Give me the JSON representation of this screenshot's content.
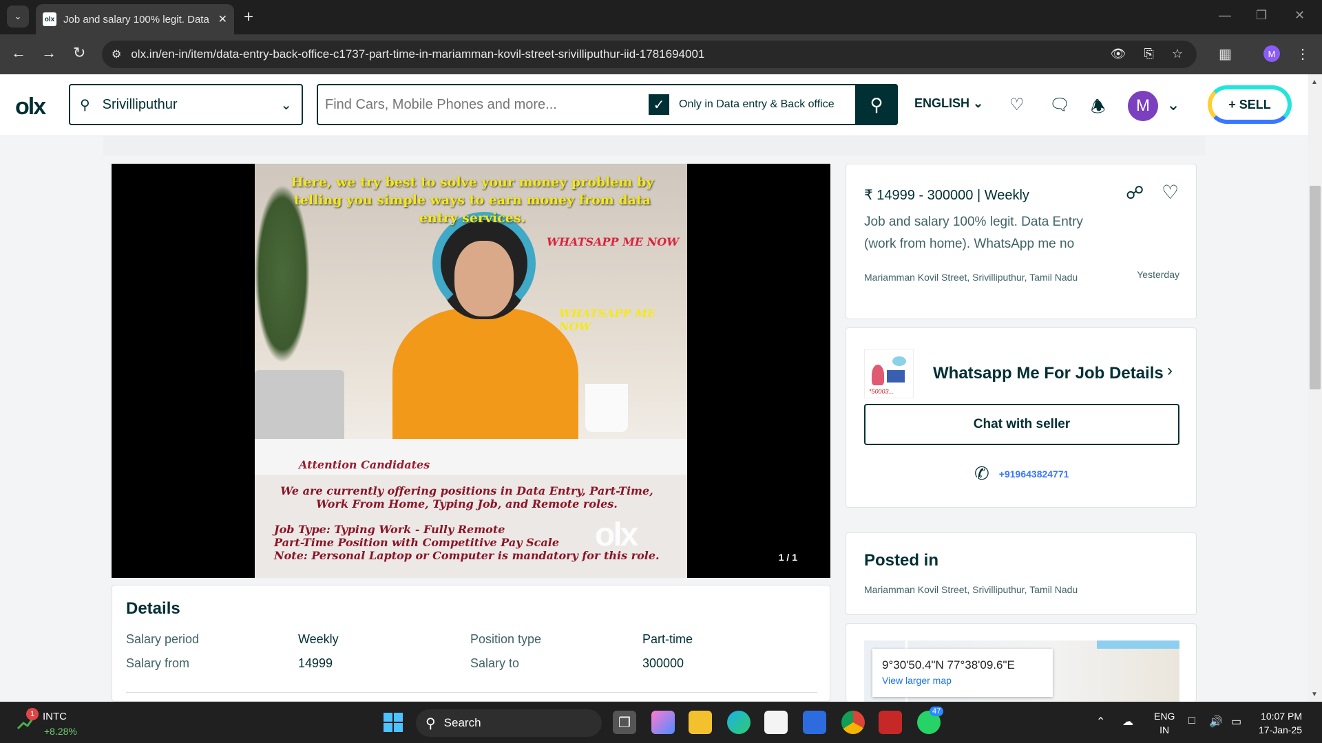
{
  "browser": {
    "tab_title": "Job and salary 100% legit. Data",
    "url": "olx.in/en-in/item/data-entry-back-office-c1737-part-time-in-mariamman-kovil-street-srivilliputhur-iid-1781694001",
    "profile_initial": "M"
  },
  "header": {
    "logo": "olx",
    "location": "Srivilliputhur",
    "search_placeholder": "Find Cars, Mobile Phones and more...",
    "filter_label": "Only in Data entry & Back office",
    "language": "ENGLISH",
    "avatar_initial": "M",
    "sell_label": "SELL"
  },
  "ad_image": {
    "headline": "Here, we try best to solve your money problem by telling you simple ways to earn money from data entry services.",
    "whatsapp_1": "WHATSAPP ME NOW",
    "whatsapp_2": "WHATSAPP ME NOW",
    "attention": "Attention Candidates",
    "line1": "We are currently offering positions in Data Entry, Part-Time, Work From Home, Typing Job, and Remote roles.",
    "line2": "Job Type: Typing Work - Fully Remote",
    "line3": "Part-Time Position with Competitive Pay Scale",
    "line4": "Note: Personal Laptop or Computer is mandatory for this role.",
    "watermark": "olx",
    "counter": "1 / 1"
  },
  "details": {
    "heading": "Details",
    "rows": [
      {
        "k1": "Salary period",
        "v1": "Weekly",
        "k2": "Position type",
        "v2": "Part-time"
      },
      {
        "k1": "Salary from",
        "v1": "14999",
        "k2": "Salary to",
        "v2": "300000"
      }
    ]
  },
  "summary": {
    "price": "₹ 14999 - 300000 | Weekly",
    "title": "Job and salary 100% legit. Data Entry (work from home). WhatsApp me no",
    "location": "Mariamman Kovil Street, Srivilliputhur, Tamil Nadu",
    "date": "Yesterday"
  },
  "seller": {
    "thumb_text": "*50003...",
    "name": "Whatsapp Me For Job Details",
    "chat_label": "Chat with seller",
    "phone": "+919643824771"
  },
  "posted": {
    "heading": "Posted in",
    "location": "Mariamman Kovil Street, Srivilliputhur, Tamil Nadu"
  },
  "map": {
    "coords": "9°30'50.4\"N 77°38'09.6\"E",
    "link": "View larger map"
  },
  "taskbar": {
    "stock_badge": "1",
    "stock_ticker": "INTC",
    "stock_change": "+8.28%",
    "search_label": "Search",
    "whatsapp_badge": "47",
    "lang_top": "ENG",
    "lang_bottom": "IN",
    "time": "10:07 PM",
    "date": "17-Jan-25"
  }
}
